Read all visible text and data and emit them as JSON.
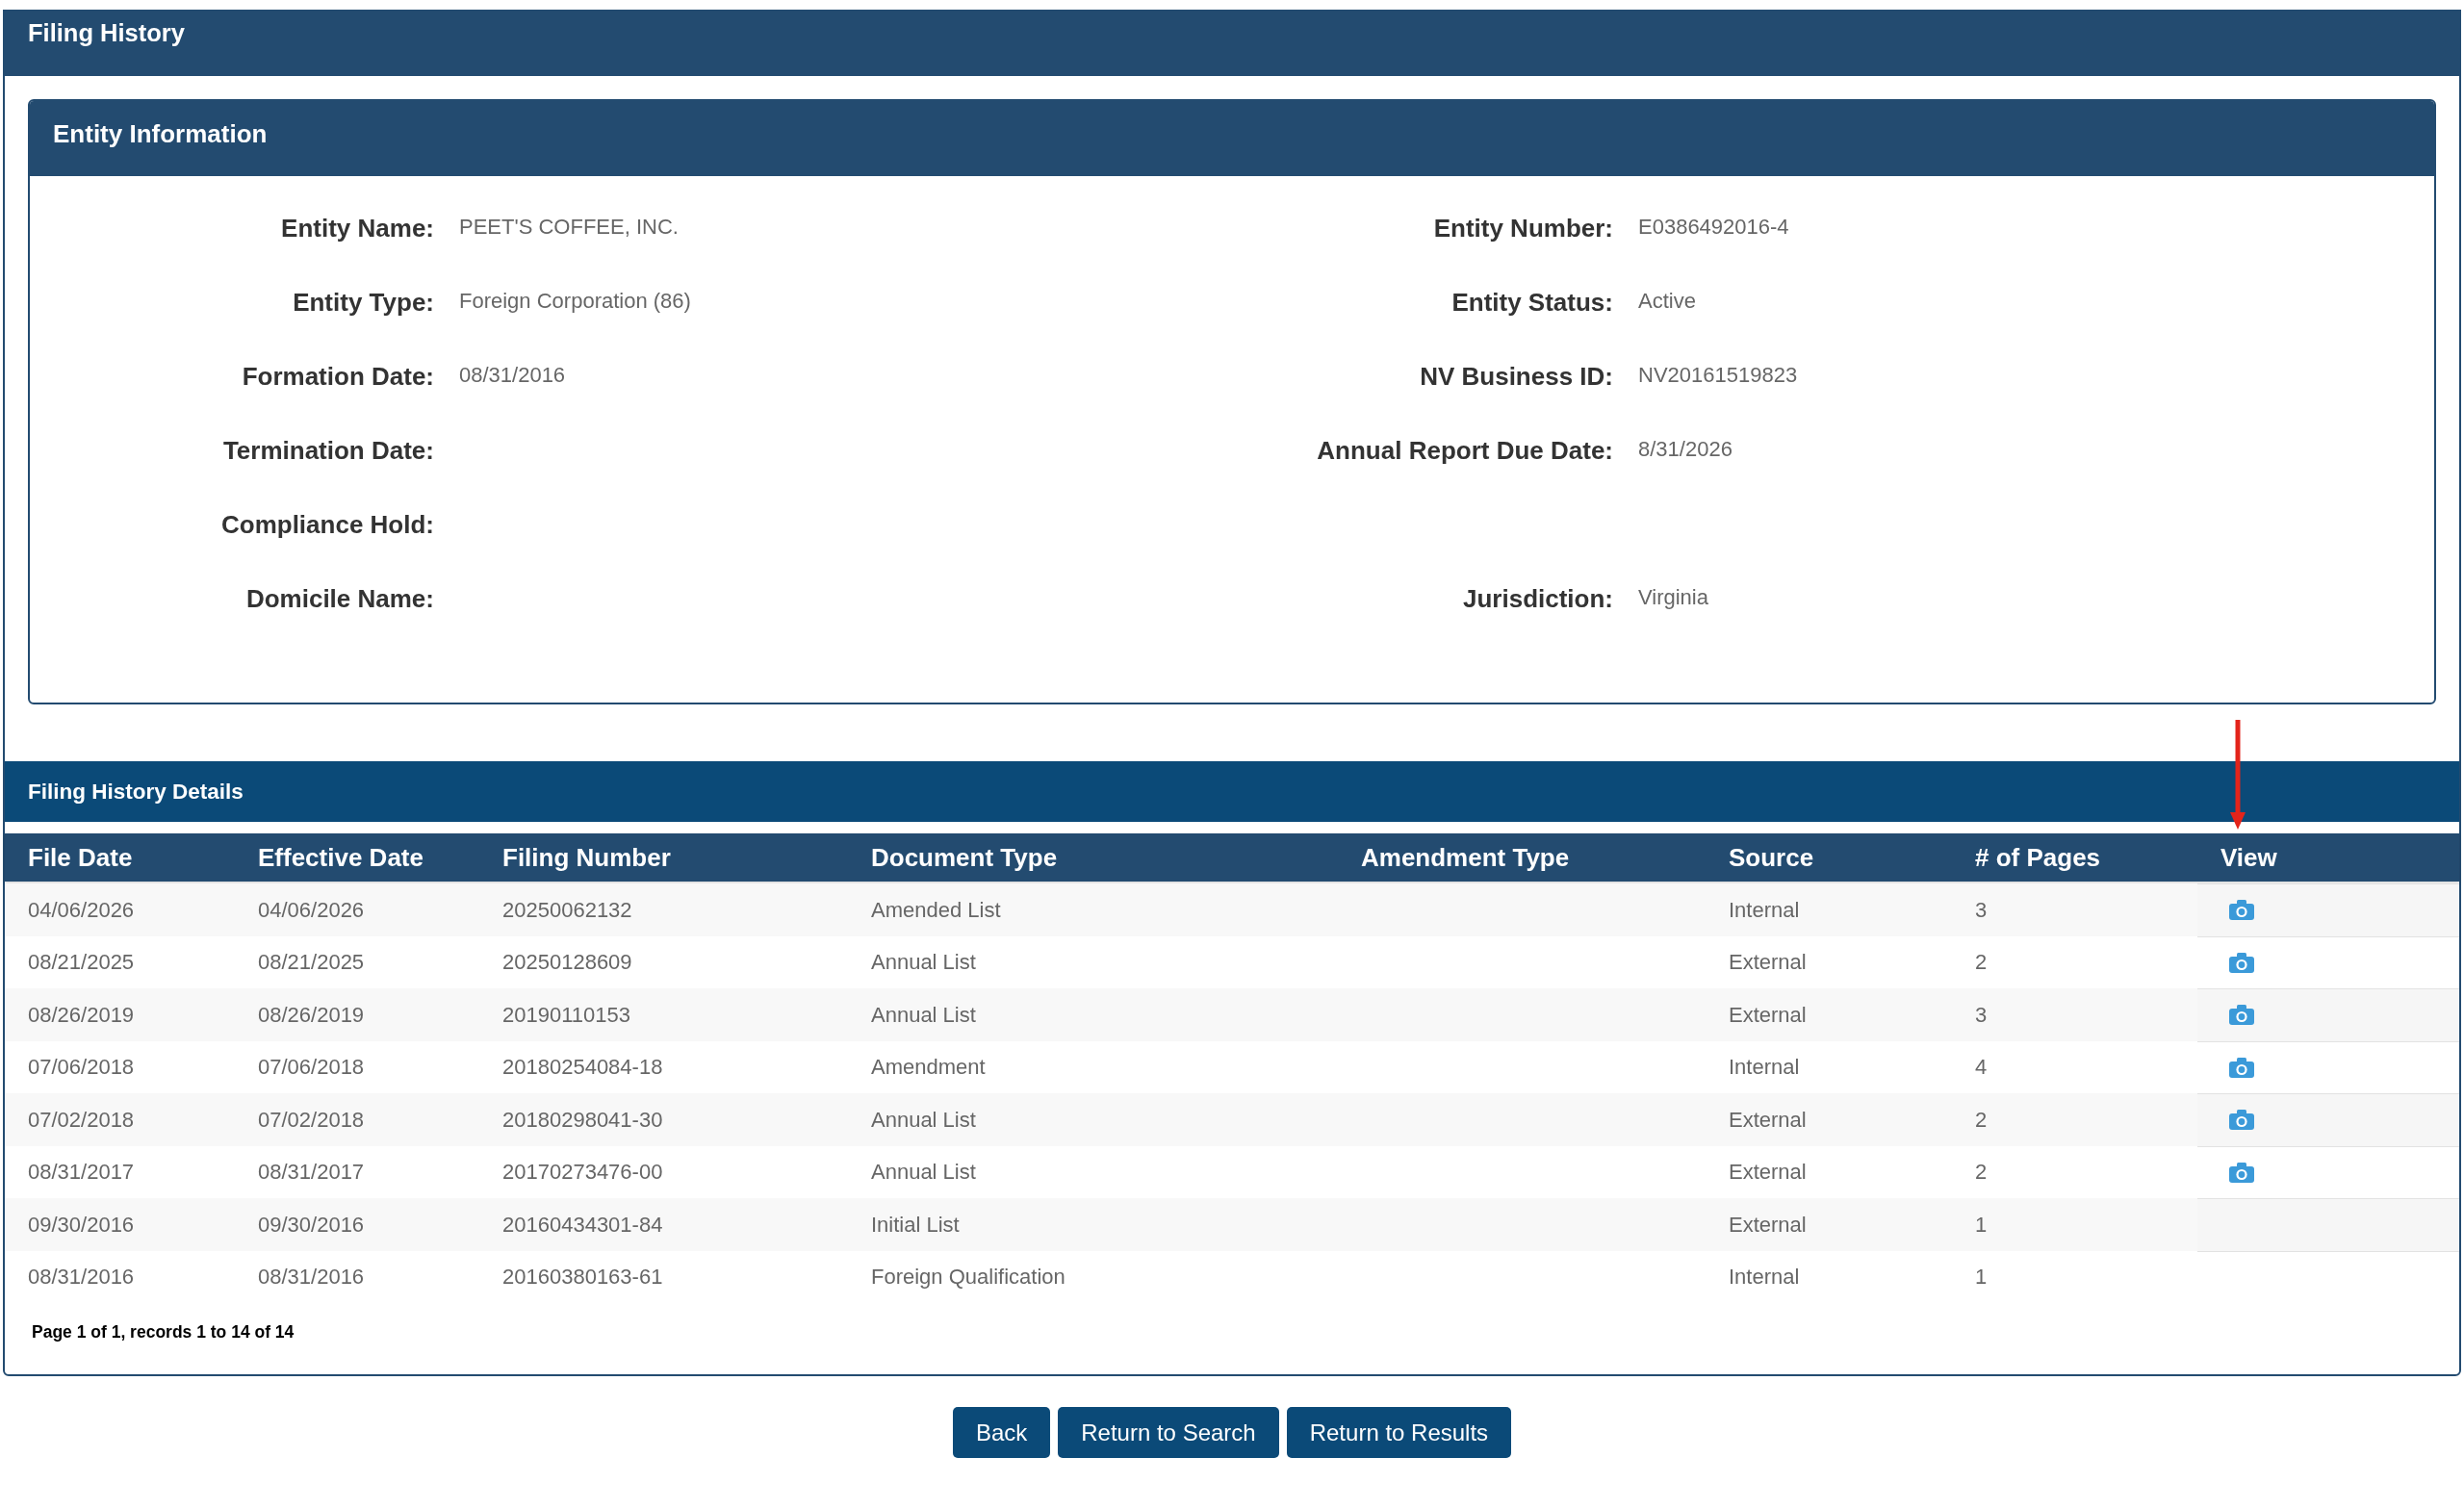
{
  "page_title": "Filing History",
  "entity_information": {
    "title": "Entity Information",
    "rows": [
      {
        "left": {
          "label": "Entity Name:",
          "value": "PEET'S COFFEE, INC."
        },
        "right": {
          "label": "Entity Number:",
          "value": "E0386492016-4"
        }
      },
      {
        "left": {
          "label": "Entity Type:",
          "value": "Foreign Corporation (86)"
        },
        "right": {
          "label": "Entity Status:",
          "value": "Active"
        }
      },
      {
        "left": {
          "label": "Formation Date:",
          "value": "08/31/2016"
        },
        "right": {
          "label": "NV Business ID:",
          "value": "NV20161519823"
        }
      },
      {
        "left": {
          "label": "Termination Date:"
        },
        "right": {
          "label": "Annual Report Due Date:",
          "value": "8/31/2026"
        }
      },
      {
        "left": {
          "label": "Compliance Hold:"
        }
      },
      {
        "left": {
          "label": "Domicile Name:"
        },
        "right": {
          "label": "Jurisdiction:",
          "value": "Virginia"
        }
      }
    ]
  },
  "filing_history_details": {
    "title": "Filing History Details",
    "table": {
      "columns": [
        "File Date",
        "Effective Date",
        "Filing Number",
        "Document Type",
        "Amendment Type",
        "Source",
        "# of Pages",
        "View"
      ],
      "rows": [
        {
          "file_date": "04/06/2026",
          "effective_date": "04/06/2026",
          "filing_number": "20250062132",
          "document_type": "Amended List",
          "source": "Internal",
          "pages": "3",
          "viewable": true
        },
        {
          "file_date": "08/21/2025",
          "effective_date": "08/21/2025",
          "filing_number": "20250128609",
          "document_type": "Annual List",
          "source": "External",
          "pages": "2",
          "viewable": true
        },
        {
          "file_date": "08/26/2019",
          "effective_date": "08/26/2019",
          "filing_number": "20190110153",
          "document_type": "Annual List",
          "source": "External",
          "pages": "3",
          "viewable": true
        },
        {
          "file_date": "07/06/2018",
          "effective_date": "07/06/2018",
          "filing_number": "20180254084-18",
          "document_type": "Amendment",
          "source": "Internal",
          "pages": "4",
          "viewable": true
        },
        {
          "file_date": "07/02/2018",
          "effective_date": "07/02/2018",
          "filing_number": "20180298041-30",
          "document_type": "Annual List",
          "source": "External",
          "pages": "2",
          "viewable": true
        },
        {
          "file_date": "08/31/2017",
          "effective_date": "08/31/2017",
          "filing_number": "20170273476-00",
          "document_type": "Annual List",
          "source": "External",
          "pages": "2",
          "viewable": true
        },
        {
          "file_date": "09/30/2016",
          "effective_date": "09/30/2016",
          "filing_number": "20160434301-84",
          "document_type": "Initial List",
          "source": "External",
          "pages": "1",
          "viewable": false
        },
        {
          "file_date": "08/31/2016",
          "effective_date": "08/31/2016",
          "filing_number": "20160380163-61",
          "document_type": "Foreign Qualification",
          "source": "Internal",
          "pages": "1",
          "viewable": false
        }
      ]
    },
    "pagination": "Page 1 of 1, records 1 to 14 of 14"
  },
  "buttons": [
    "Back",
    "Return to Search",
    "Return to Results"
  ],
  "annotations": [
    {
      "kind": "arrow"
    }
  ]
}
